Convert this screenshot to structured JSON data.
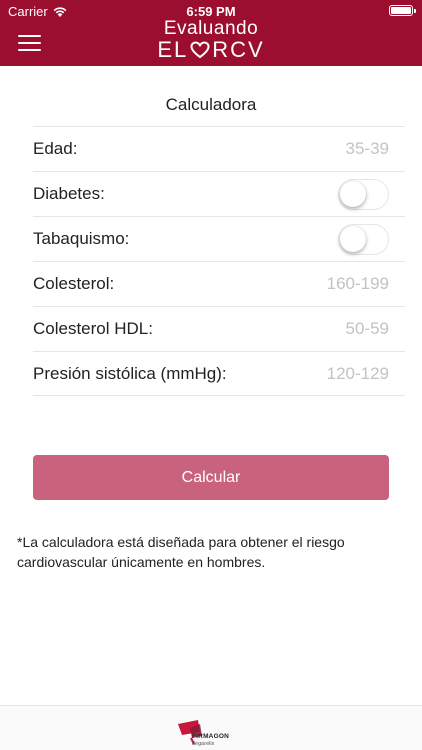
{
  "status_bar": {
    "carrier": "Carrier",
    "time": "6:59 PM"
  },
  "header": {
    "logo_line1": "Evaluando",
    "logo_line2_left": "EL",
    "logo_line2_right": "RCV",
    "brand_color": "#9b0e2f"
  },
  "calculator": {
    "title": "Calculadora",
    "fields": [
      {
        "label": "Edad:",
        "value": "35-39",
        "type": "select"
      },
      {
        "label": "Diabetes:",
        "type": "toggle",
        "on": false
      },
      {
        "label": "Tabaquismo:",
        "type": "toggle",
        "on": false
      },
      {
        "label": "Colesterol:",
        "value": "160-199",
        "type": "select"
      },
      {
        "label": "Colesterol HDL:",
        "value": "50-59",
        "type": "select"
      },
      {
        "label": "Presión sistólica (mmHg):",
        "value": "120-129",
        "type": "select"
      }
    ],
    "button_label": "Calcular",
    "button_color": "#c9627c"
  },
  "disclaimer": "*La calculadora está diseñada para obtener el riesgo cardiovascular únicamente en hombres.",
  "footer": {
    "brand": "FIRMAGON",
    "sub": "degarelix"
  }
}
